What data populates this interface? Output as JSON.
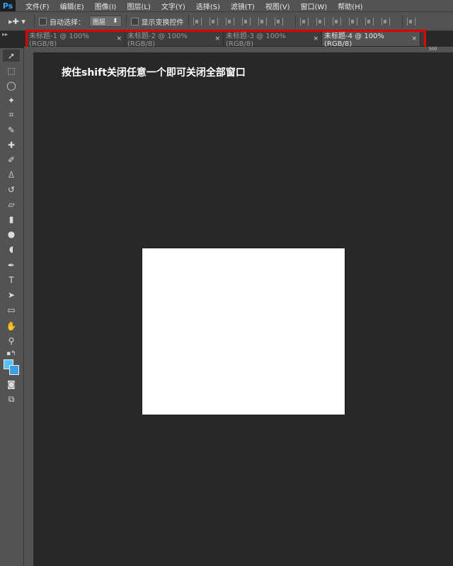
{
  "app": {
    "logo": "Ps"
  },
  "menu": [
    "文件(F)",
    "编辑(E)",
    "图像(I)",
    "图层(L)",
    "文字(Y)",
    "选择(S)",
    "滤镜(T)",
    "视图(V)",
    "窗口(W)",
    "帮助(H)"
  ],
  "options": {
    "tool_glyph": "▸✚ ▾",
    "auto_select_label": "自动选择：",
    "auto_select_value": "图层",
    "show_transform_label": "显示变换控件"
  },
  "tabs": [
    {
      "label": "未标题-1 @ 100%(RGB/8)",
      "close": "×",
      "active": false
    },
    {
      "label": "未标题-2 @ 100%(RGB/8)",
      "close": "×",
      "active": false
    },
    {
      "label": "未标题-3 @ 100%(RGB/8)",
      "close": "×",
      "active": false
    },
    {
      "label": "未标题-4 @ 100%(RGB/8)",
      "close": "×",
      "active": true
    }
  ],
  "ruler_top_label": "500",
  "instruction": "按住shift关闭任意一个即可关闭全部窗口",
  "colors": {
    "accent": "#e00000",
    "foreground": "#53c4f7",
    "background": "#3d9ee8"
  },
  "tools": [
    "move-tool-icon",
    "marquee-tool-icon",
    "lasso-tool-icon",
    "magic-wand-icon",
    "crop-tool-icon",
    "eyedropper-icon",
    "healing-brush-icon",
    "brush-tool-icon",
    "clone-stamp-icon",
    "history-brush-icon",
    "eraser-icon",
    "gradient-tool-icon",
    "blur-tool-icon",
    "dodge-tool-icon",
    "pen-tool-icon",
    "type-tool-icon",
    "path-selection-icon",
    "rectangle-tool-icon",
    "hand-tool-icon",
    "zoom-tool-icon"
  ]
}
